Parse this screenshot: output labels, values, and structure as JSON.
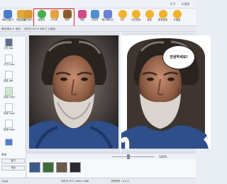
{
  "title_bar": {
    "buttons": [
      "도구",
      "도움말"
    ]
  },
  "toolbar": {
    "tools": [
      {
        "label": "새로만들기",
        "icon": "new-file-icon",
        "color": "#4a7bd0"
      },
      {
        "label": "파일열기",
        "icon": "open-folder-icon",
        "color": "#e1a93a"
      },
      {
        "label": "폴더열기",
        "icon": "folder-icon",
        "color": "#d89b2f"
      },
      {
        "label": "말풍선",
        "icon": "speech-bubble-icon",
        "color": "#43b04a"
      },
      {
        "label": "스티커",
        "icon": "sticker-icon",
        "color": "#e6a33c"
      },
      {
        "label": "액자",
        "icon": "frame-icon",
        "color": "#8b5a2b"
      },
      {
        "label": "색상",
        "icon": "color-icon",
        "color": "#d24a8c"
      },
      {
        "label": "이미지",
        "icon": "image-icon",
        "color": "#4d8fd6"
      },
      {
        "label": "애니메이션",
        "icon": "animation-icon",
        "color": "#6b7fd7"
      },
      {
        "label": "GIF",
        "icon": "gif-icon",
        "color": "#f0b22a"
      },
      {
        "label": "사진편집",
        "icon": "photo-edit-icon",
        "color": "#f0b22a"
      },
      {
        "label": "설정",
        "icon": "gear-icon",
        "color": "#f0b22a"
      },
      {
        "label": "환경설정",
        "icon": "settings-icon",
        "color": "#f0b22a"
      },
      {
        "label": "도움말",
        "icon": "help-icon",
        "color": "#f0b22a"
      }
    ]
  },
  "menubar": {
    "items": [
      "확대/축소 ▾",
      "회전",
      "이미지 크기 ▾",
      "자르기",
      "도움말"
    ]
  },
  "sidebar": {
    "header": "",
    "files": [
      {
        "name": "사진.jpg"
      },
      {
        "name": "사진2.jpg"
      },
      {
        "name": "얼굴.jpg"
      },
      {
        "name": "얼굴2.jpg"
      },
      {
        "name": "얼굴3.jpg"
      },
      {
        "name": "얼굴4.jpg"
      }
    ],
    "section_label": "확대",
    "buttons": [
      "열기",
      "저장"
    ]
  },
  "canvas": {
    "speech_bubble_text": "안녕하세요!",
    "zoom_value": "100%"
  },
  "filmstrip": {
    "count": 4
  },
  "status": {
    "left": "1.jpg",
    "center": "이미지 크기 : 640 x 480",
    "right": "선택영역 : 0 x 0"
  },
  "colors": {
    "accent": "#e0242b",
    "background": "#e9eef5",
    "toolbar": "#f3f5f9"
  }
}
